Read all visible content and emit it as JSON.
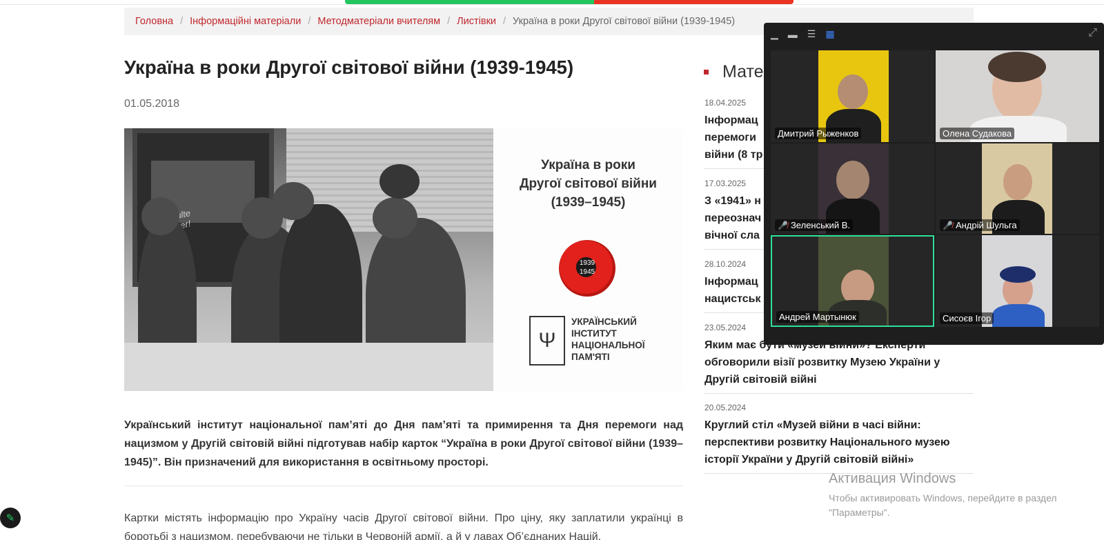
{
  "breadcrumb": [
    {
      "label": "Головна"
    },
    {
      "label": "Інформаційні матеріали"
    },
    {
      "label": "Методматеріали вчителям"
    },
    {
      "label": "Листівки"
    },
    {
      "label": "Україна в роки Другої світової війни (1939-1945)"
    }
  ],
  "article": {
    "title": "Україна в роки Другої світової війни (1939-1945)",
    "date": "01.05.2018",
    "card_title": "Україна в роки\nДругої світової війни\n(1939–1945)",
    "poppy_text": "1939\n1945",
    "institute": "УКРАЇНСЬКИЙ\nІНСТИТУТ\nНАЦІОНАЛЬНОЇ\nПАМ'ЯТІ",
    "photo_scribble": "Zonsulte\nMukher!",
    "lead": "Український інститут національної пам’яті до Дня пам’яті та примирення та Дня перемоги над нацизмом у Другій світовій війні підготував набір карток “Україна в роки Другої світової війни (1939–1945)”. Він призначений для використання в освітньому просторі.",
    "body": "Картки містять інформацію про Україну часів Другої світової війни. Про ціну, яку заплатили українці в боротьбі з нацизмом, перебуваючи не тільки в Червоній армії, а й у лавах Об’єднаних Націй."
  },
  "sidebar": {
    "heading": "Мате",
    "news": [
      {
        "date": "18.04.2025",
        "title": "Інформац\nперемоги\nвійни (8 тр"
      },
      {
        "date": "17.03.2025",
        "title": "З «1941» н\nпереознач\nвічної сла"
      },
      {
        "date": "28.10.2024",
        "title": "Інформац\nнацистськ"
      },
      {
        "date": "23.05.2024",
        "title": "Яким має бути «музей війни»? Експерти обговорили візії розвитку Музею України у Другій світовій війні"
      },
      {
        "date": "20.05.2024",
        "title": "Круглий стіл «Музей війни в часі війни: перспективи розвитку Національного музею історії України у Другій світовій війні»"
      }
    ]
  },
  "zoom": {
    "participants": [
      {
        "name": "Дмитрий Рыженков",
        "muted": false
      },
      {
        "name": "Олена Судакова",
        "muted": false
      },
      {
        "name": "Зеленський В.",
        "muted": true
      },
      {
        "name": "Андрій Шульга",
        "muted": true
      },
      {
        "name": "Андрей Мартынюк",
        "muted": false
      },
      {
        "name": "Сисоєв Ігор",
        "muted": false
      }
    ],
    "active_color": "#2ee09a"
  },
  "windows": {
    "line1": "Активация Windows",
    "line2": "Чтобы активировать Windows, перейдите в раздел \"Параметры\"."
  },
  "icons": {
    "edit": "pencil-icon",
    "zoom_minimize": "minimize-icon",
    "zoom_single": "single-view-icon",
    "zoom_stacked": "stacked-view-icon",
    "zoom_gallery": "gallery-view-icon",
    "zoom_expand": "expand-icon",
    "mic_muted": "muted-mic-icon"
  },
  "colors": {
    "brand": "#c0272d",
    "share_green": "#22c55e",
    "share_red": "#ea3323"
  }
}
